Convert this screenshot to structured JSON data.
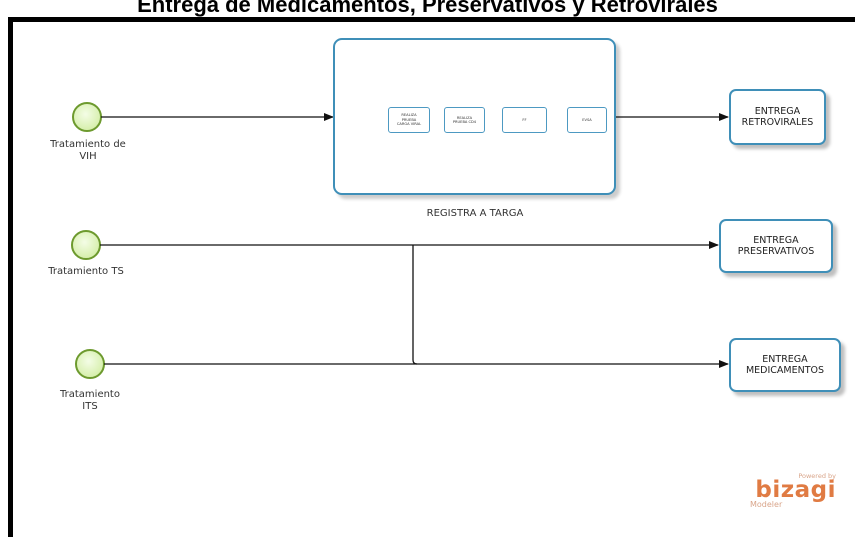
{
  "title": "Entrega de Medicamentos, Preservativos y Retrovirales",
  "events": [
    {
      "id": "vih",
      "label": "Tratamiento de\nVIH"
    },
    {
      "id": "ts",
      "label": "Tratamiento TS"
    },
    {
      "id": "its",
      "label": "Tratamiento\nITS"
    }
  ],
  "subprocess": {
    "label": "REGISTRA A TARGA",
    "tasks": [
      "REALIZA\nPRUEBA\nCARGA VIRAL",
      "REALIZA\nPRUEBA CD4",
      "FF",
      "EVSA"
    ]
  },
  "tasks": [
    {
      "id": "retro",
      "label": "ENTREGA\nRETROVIRALES"
    },
    {
      "id": "pres",
      "label": "ENTREGA\nPRESERVATIVOS"
    },
    {
      "id": "med",
      "label": "ENTREGA\nMEDICAMENTOS"
    }
  ],
  "watermark": {
    "powered": "Powered by",
    "brand": "bizagi",
    "product": "Modeler"
  },
  "colors": {
    "task_border": "#3f8fb8",
    "event_fill": "#e4f6c5",
    "event_stroke": "#6d9a2e",
    "brand": "#e07b43"
  }
}
